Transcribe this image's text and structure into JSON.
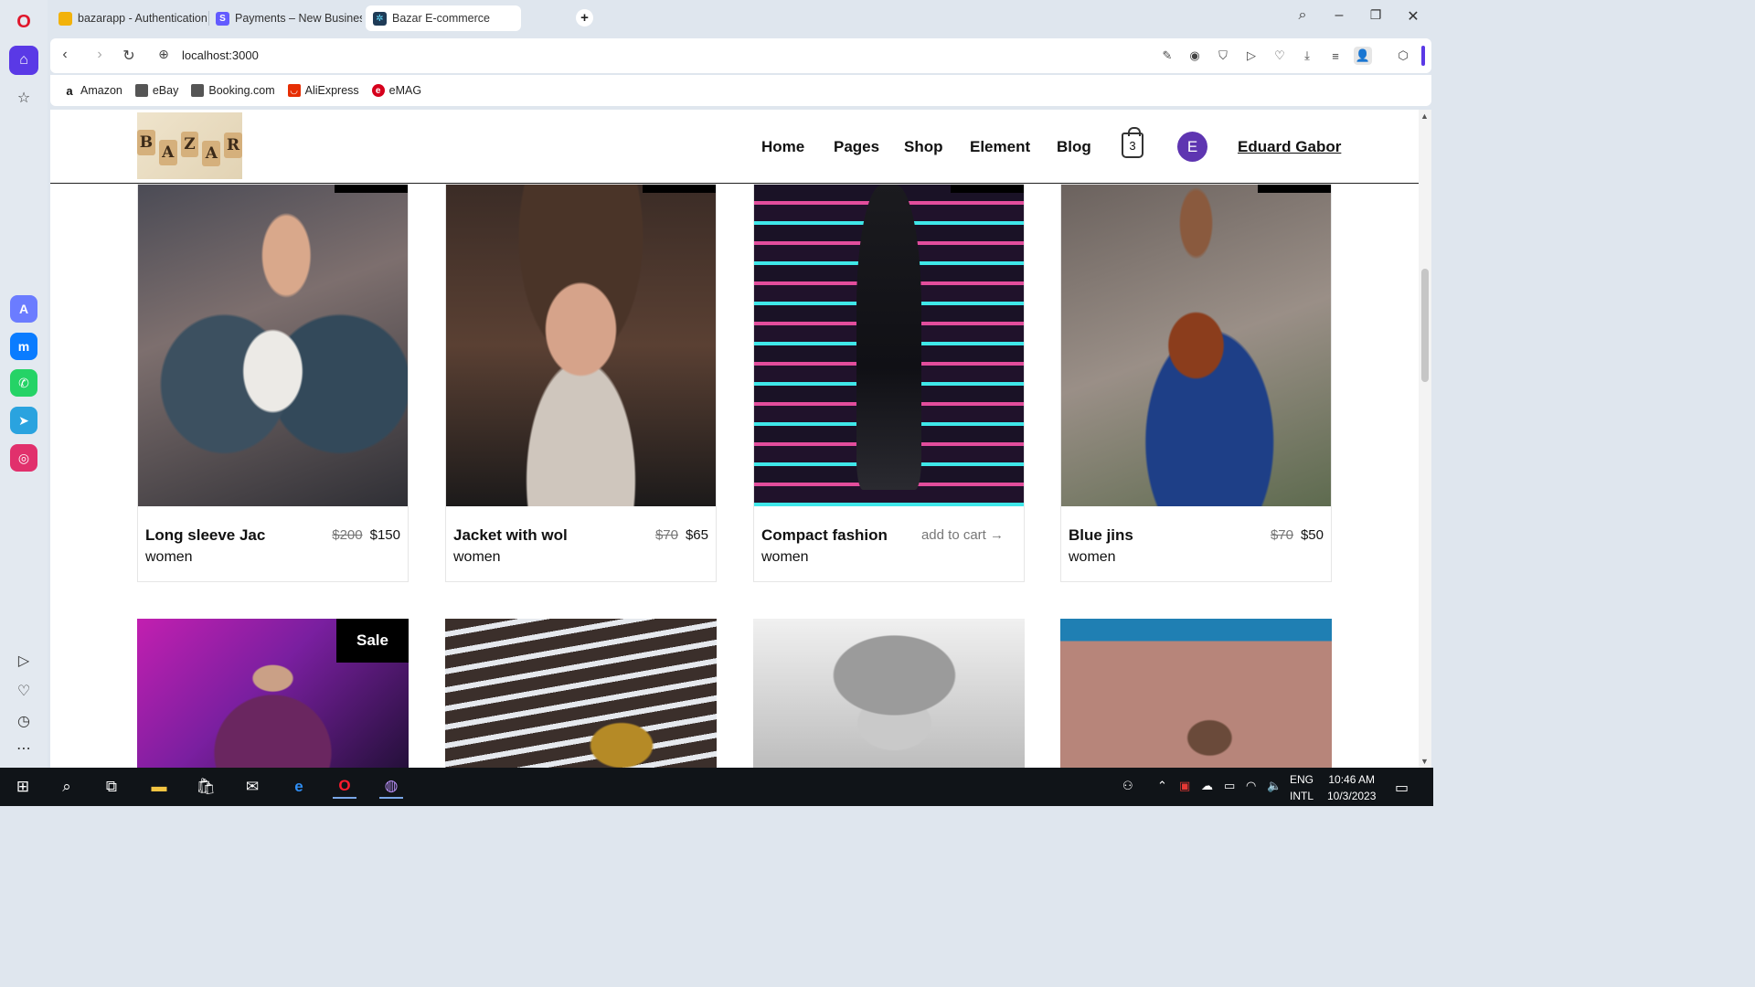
{
  "browser": {
    "tabs": [
      {
        "title": "bazarapp - Authentication",
        "favicon_color": "#f2b20a"
      },
      {
        "title": "Payments – New Business",
        "favicon_color": "#635bff"
      },
      {
        "title": "Bazar E-commerce",
        "favicon_color": "#1f3b57"
      }
    ],
    "url": "localhost:3000",
    "bookmarks": [
      {
        "label": "Amazon",
        "icon": "amazon-icon"
      },
      {
        "label": "eBay",
        "icon": "document-icon"
      },
      {
        "label": "Booking.com",
        "icon": "document-icon"
      },
      {
        "label": "AliExpress",
        "icon": "aliexpress-icon"
      },
      {
        "label": "eMAG",
        "icon": "emag-icon"
      }
    ],
    "accent_color": "#5a39e6"
  },
  "site": {
    "logo_letters": [
      "B",
      "A",
      "Z",
      "A",
      "R"
    ],
    "nav": [
      "Home",
      "Pages",
      "Shop",
      "Element",
      "Blog"
    ],
    "cart_count": "3",
    "user_initial": "E",
    "user_name": "Eduard Gabor"
  },
  "products_row1": [
    {
      "name": "Long sleeve Jac",
      "category": "women",
      "old_price": "$200",
      "price": "$150"
    },
    {
      "name": "Jacket with wol",
      "category": "women",
      "old_price": "$70",
      "price": "$65"
    },
    {
      "name": "Compact fashion",
      "category": "women",
      "action": "add to cart →"
    },
    {
      "name": "Blue jins",
      "category": "women",
      "old_price": "$70",
      "price": "$50"
    }
  ],
  "products_row2": [
    {
      "badge": "Sale"
    }
  ],
  "taskbar": {
    "language_line1": "ENG",
    "language_line2": "INTL",
    "time": "10:46 AM",
    "date": "10/3/2023"
  }
}
